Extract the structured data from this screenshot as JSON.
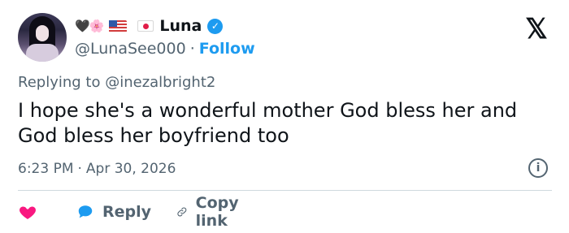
{
  "author": {
    "name_emoji": "🖤🌸",
    "display_name": "Luna",
    "handle": "@LunaSee000",
    "separator": "·",
    "follow_label": "Follow"
  },
  "reply_context": {
    "prefix": "Replying to",
    "target": "@inezalbright2"
  },
  "tweet": {
    "text": "I hope she's a wonderful mother God bless her and God bless her boyfriend too"
  },
  "timestamp": {
    "time": "6:23 PM",
    "separator": "·",
    "date": "Apr 30, 2026"
  },
  "actions": {
    "reply_label": "Reply",
    "copy_link_label": "Copy link"
  },
  "icons": {
    "brand": "x-logo",
    "verified": "verified-badge-icon",
    "info": "info-icon",
    "like": "heart-icon",
    "reply": "speech-bubble-icon",
    "copy": "link-icon"
  },
  "colors": {
    "accent": "#1d9bf0",
    "muted": "#536471",
    "like": "#f91880",
    "text": "#0f1419"
  }
}
